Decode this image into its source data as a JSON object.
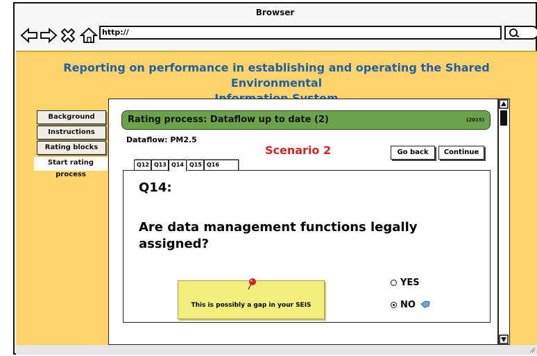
{
  "browser": {
    "title": "Browser",
    "address": "http://"
  },
  "page": {
    "heading_line1": "Reporting on performance in establishing and operating the Shared Environmental",
    "heading_line2": "Information System"
  },
  "sidebar": {
    "items": [
      {
        "label": "Background"
      },
      {
        "label": "Instructions"
      },
      {
        "label": "Rating blocks"
      },
      {
        "label": "Start rating process"
      }
    ]
  },
  "panel": {
    "title": "Rating process: Dataflow up to date (2)",
    "year": "(2015)",
    "dataflow": "Dataflow: PM2.5",
    "scenario": "Scenario 2",
    "go_back": "Go back",
    "continue": "Continue",
    "tabs": [
      {
        "label": "Q12"
      },
      {
        "label": "Q13"
      },
      {
        "label": "Q14"
      },
      {
        "label": "Q15"
      },
      {
        "label": "Q16"
      }
    ],
    "question_number": "Q14:",
    "question_text": "Are data management functions legally assigned?",
    "note": "This is possibly a gap in your SEIS",
    "options": [
      {
        "label": "YES",
        "selected": false
      },
      {
        "label": "NO",
        "selected": true
      }
    ]
  },
  "colors": {
    "background": "#fdd36a",
    "heading": "#1f5fa8",
    "title_bar": "#6aa34a",
    "scenario": "#e02020",
    "note": "#f3ef7c"
  },
  "icons": [
    "back-arrow-icon",
    "forward-arrow-icon",
    "close-icon",
    "home-icon",
    "search-icon",
    "pushpin-icon",
    "cursor-hand-icon",
    "scroll-up-icon",
    "scroll-down-icon",
    "resize-grip-icon"
  ]
}
